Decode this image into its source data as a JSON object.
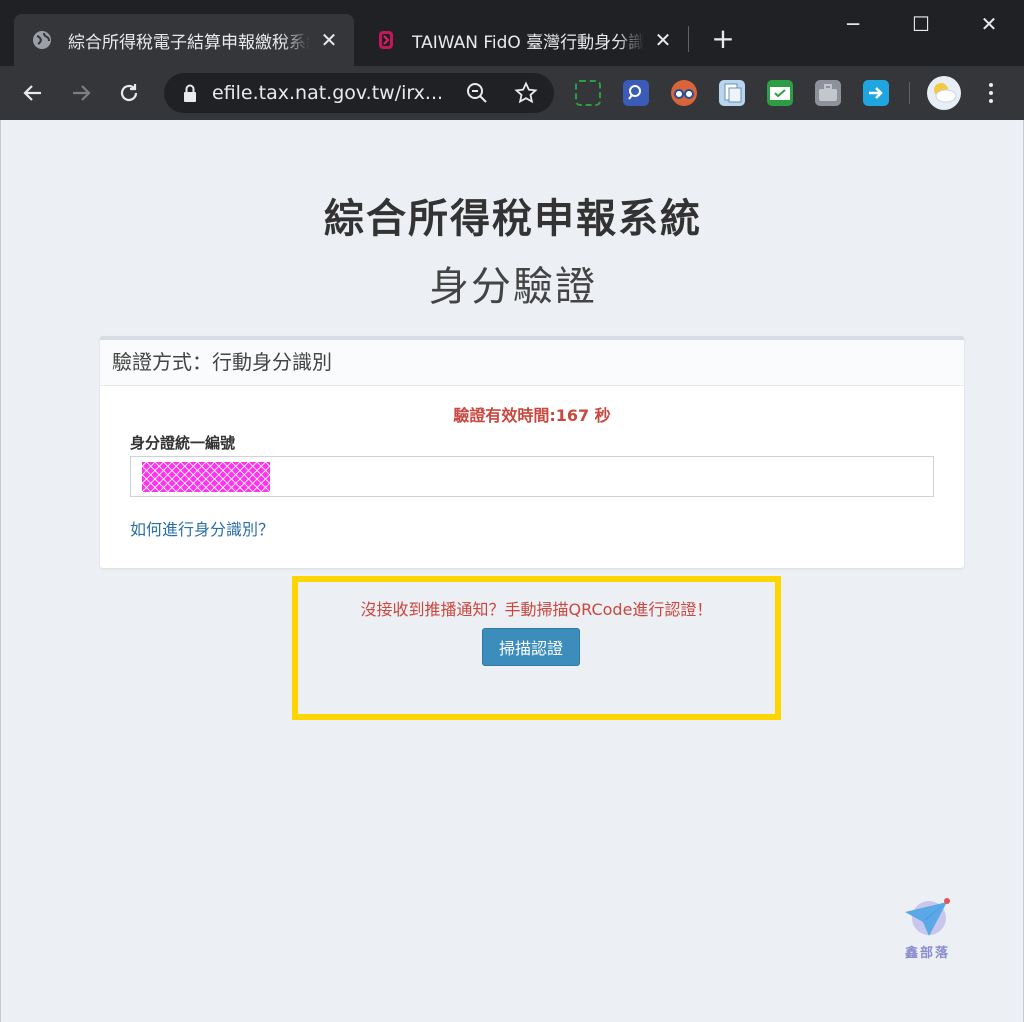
{
  "browser": {
    "tabs": [
      {
        "title": "綜合所得稅電子結算申報繳稅系統",
        "active": true,
        "close": "✕"
      },
      {
        "title": "TAIWAN FidO 臺灣行動身分識別",
        "active": false,
        "close": "✕"
      }
    ],
    "new_tab": "+",
    "window_controls": {
      "minimize": "─",
      "maximize": "☐",
      "close": "✕"
    },
    "url": "efile.tax.nat.gov.tw/irx...",
    "icons": [
      "back-arrow-icon",
      "forward-arrow-icon",
      "reload-icon",
      "lock-icon",
      "zoom-icon",
      "star-icon",
      "menu-dots-icon"
    ]
  },
  "page": {
    "title": "綜合所得稅申報系統",
    "subtitle": "身分驗證",
    "panel": {
      "header": "驗證方式：行動身分識別",
      "timer": "驗證有效時間:167 秒",
      "field_label": "身分證統一編號",
      "help_link": "如何進行身分識別？"
    },
    "scan_section": {
      "notice": "沒接收到推播通知？手動掃描QRCode進行認證！",
      "button": "掃描認證"
    },
    "watermark": "鑫部落"
  },
  "colors": {
    "accent_button": "#3c8dbc",
    "warning_text": "#c9483f",
    "highlight_border": "#ffd500",
    "link": "#2a6fa8"
  }
}
